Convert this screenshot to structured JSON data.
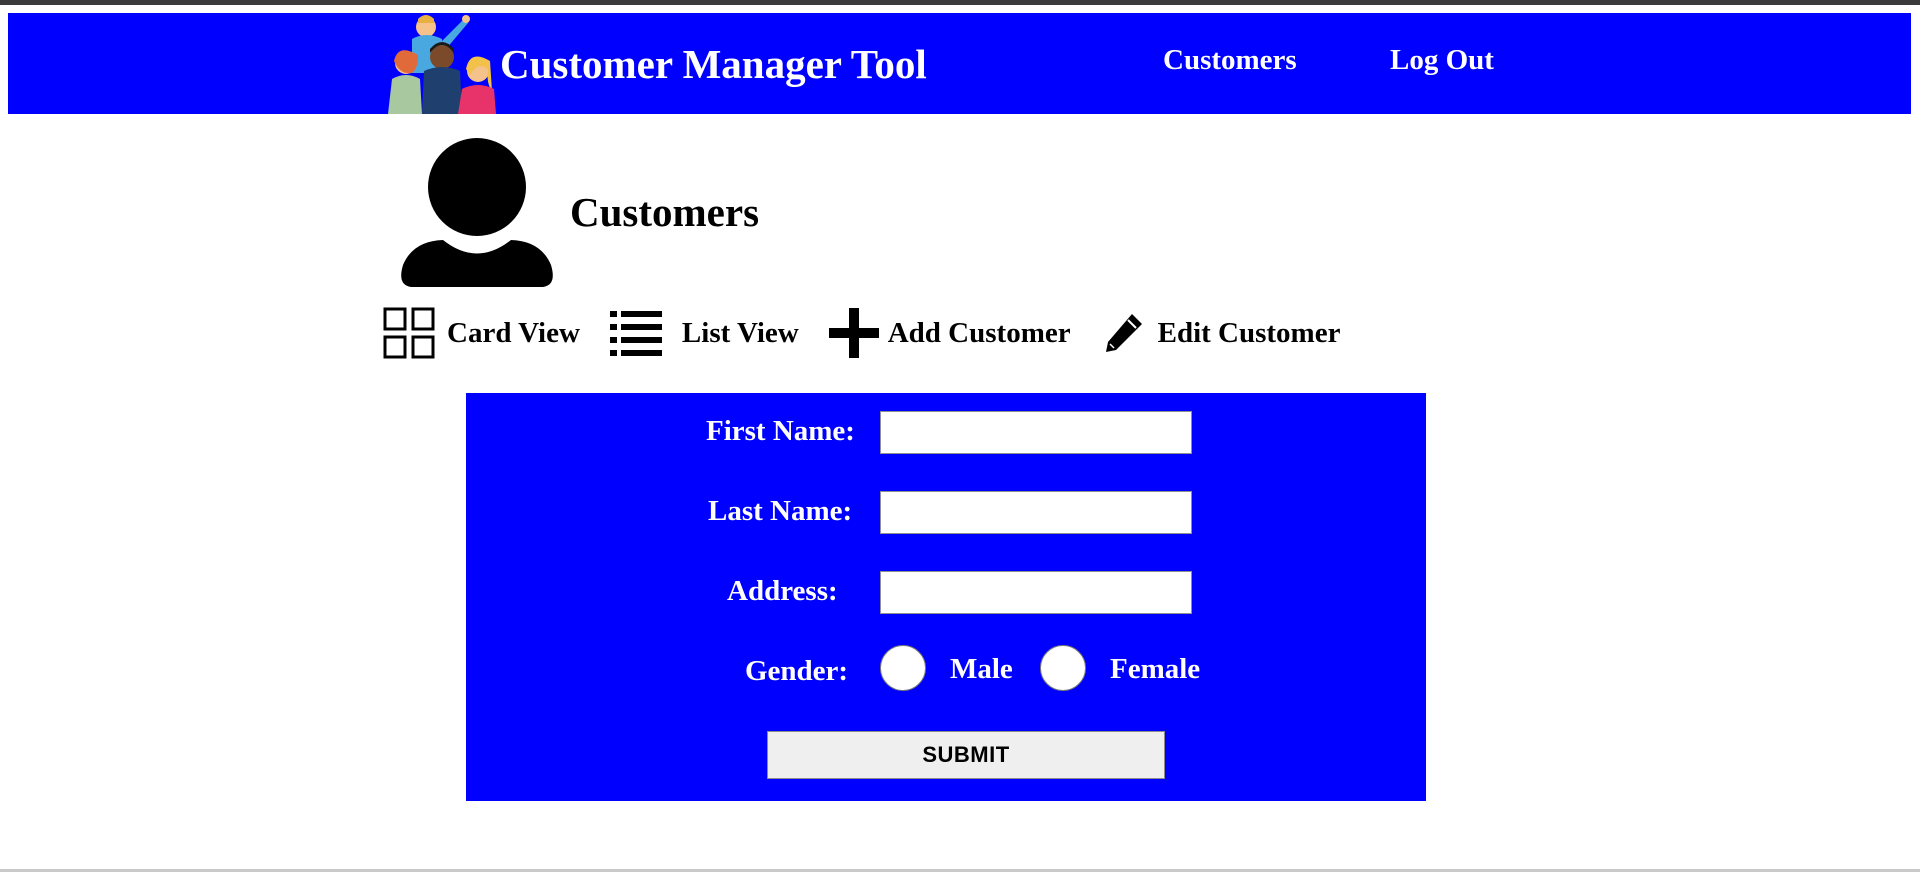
{
  "header": {
    "brand": "Customer Manager Tool",
    "nav": {
      "customers": "Customers",
      "logout": "Log Out"
    },
    "nav_color": "#0000ff"
  },
  "page": {
    "title": "Customers",
    "icon": "person-silhouette-icon"
  },
  "toolbar": {
    "card_view": "Card View",
    "list_view": "List View",
    "add_customer": "Add Customer",
    "edit_customer": "Edit Customer"
  },
  "form": {
    "first_name_label": "First Name:",
    "first_name_value": "",
    "last_name_label": "Last Name:",
    "last_name_value": "",
    "address_label": "Address:",
    "address_value": "",
    "gender_label": "Gender:",
    "gender_options": [
      "Male",
      "Female"
    ],
    "submit_label": "SUBMIT",
    "panel_color": "#0000ff"
  }
}
